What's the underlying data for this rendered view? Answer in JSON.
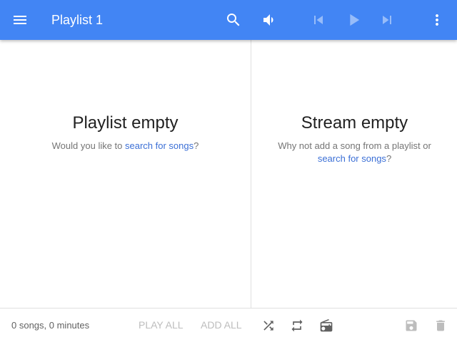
{
  "topbar": {
    "title": "Playlist 1",
    "background_color": "#4285f4",
    "icons": [
      "menu-icon",
      "search-icon",
      "volume-icon",
      "skip-previous-icon",
      "play-icon",
      "skip-next-icon",
      "more-vert-icon"
    ]
  },
  "playlist_panel": {
    "title": "Playlist empty",
    "text_before": "Would you like to ",
    "link": "search for songs",
    "text_after": "?"
  },
  "stream_panel": {
    "title": "Stream empty",
    "text_before": "Why not add a song from a playlist or ",
    "link": "search for songs",
    "text_after": "?"
  },
  "bottombar": {
    "song_count": "0 songs, 0 minutes",
    "play_all": "PLAY ALL",
    "add_all": "ADD ALL",
    "icons": [
      "shuffle-icon",
      "repeat-icon",
      "radio-icon",
      "save-icon",
      "delete-icon"
    ]
  },
  "colors": {
    "accent": "#4285f4",
    "link": "#3b6fd6",
    "disabled": "#bdbdbd"
  }
}
